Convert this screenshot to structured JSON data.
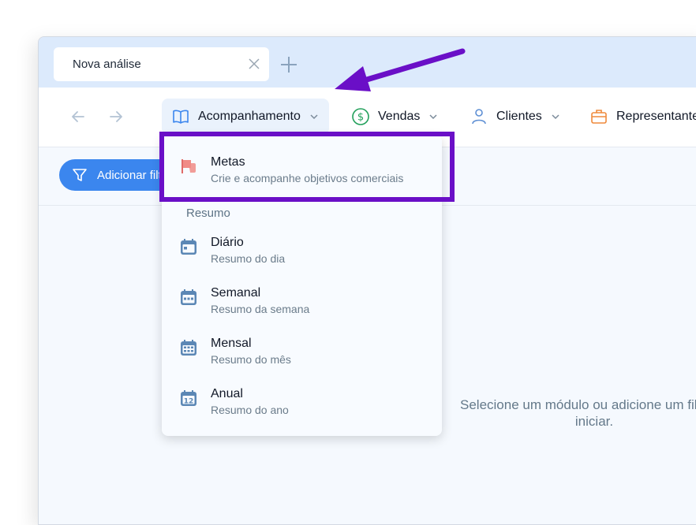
{
  "tab": {
    "title": "Nova análise"
  },
  "nav": {
    "menus": [
      {
        "label": "Acompanhamento"
      },
      {
        "label": "Vendas"
      },
      {
        "label": "Clientes"
      },
      {
        "label": "Representantes"
      }
    ]
  },
  "filter": {
    "label": "Adicionar filtro"
  },
  "empty_state": {
    "line1": "Selecione um módulo ou adicione um filtro para",
    "line2": "iniciar."
  },
  "dropdown": {
    "metas": {
      "title": "Metas",
      "subtitle": "Crie e acompanhe objetivos comerciais"
    },
    "section": "Resumo",
    "items": [
      {
        "title": "Diário",
        "subtitle": "Resumo do dia"
      },
      {
        "title": "Semanal",
        "subtitle": "Resumo da semana"
      },
      {
        "title": "Mensal",
        "subtitle": "Resumo do mês"
      },
      {
        "title": "Anual",
        "subtitle": "Resumo do ano"
      }
    ]
  },
  "colors": {
    "accent": "#3b86ee",
    "highlight": "#6a0fc7",
    "tabbar": "#dceafc"
  }
}
